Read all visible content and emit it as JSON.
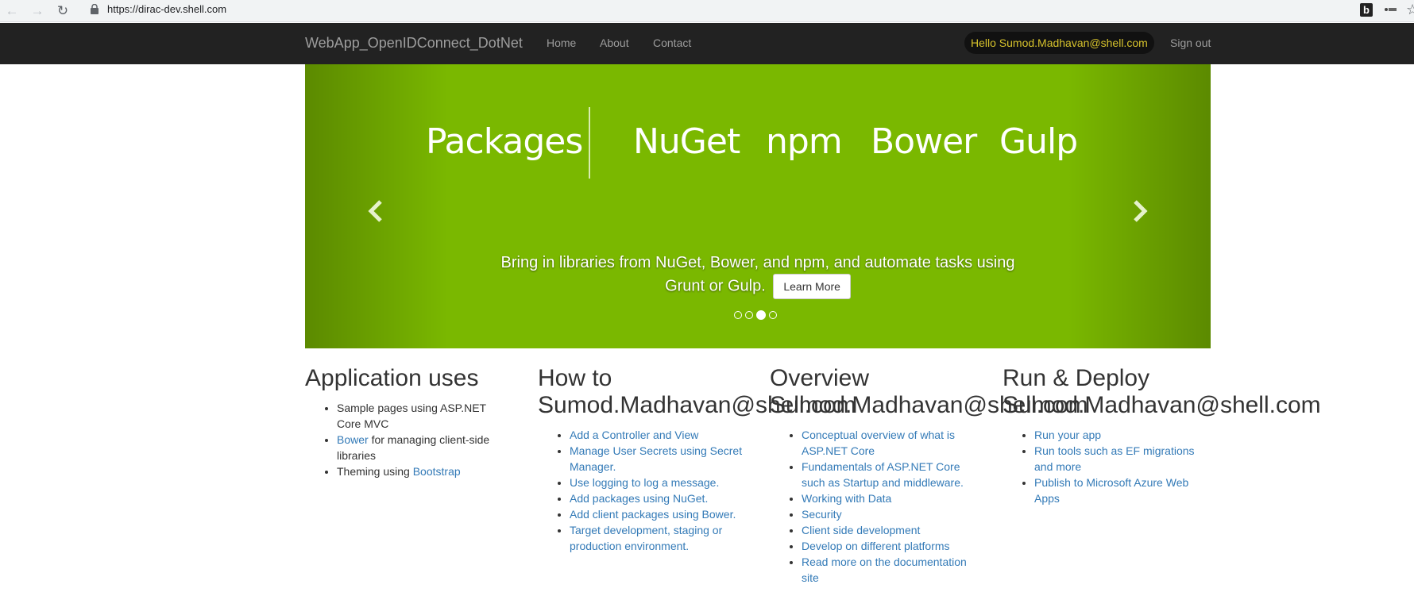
{
  "browser": {
    "url": "https://dirac-dev.shell.com"
  },
  "navbar": {
    "brand": "WebApp_OpenIDConnect_DotNet",
    "links": [
      "Home",
      "About",
      "Contact"
    ],
    "hello": "Hello Sumod.Madhavan@shell.com",
    "signout": "Sign out"
  },
  "carousel": {
    "title": "Packages",
    "items": [
      "NuGet",
      "npm",
      "Bower",
      "Gulp"
    ],
    "caption": "Bring in libraries from NuGet, Bower, and npm, and automate tasks using Grunt or Gulp.",
    "button": "Learn More",
    "active_slide": 3,
    "slide_count": 4,
    "colors": {
      "background": "#7ab800"
    }
  },
  "sections": {
    "app_uses": {
      "heading": "Application uses",
      "item1": "Sample pages using ASP.NET Core MVC",
      "item2_link": "Bower",
      "item2_text": " for managing client-side libraries",
      "item3_text": "Theming using ",
      "item3_link": "Bootstrap"
    },
    "how_to": {
      "heading_line1": "How to",
      "heading_line2": "Sumod.Madhavan@shell.com",
      "links": [
        "Add a Controller and View",
        "Manage User Secrets using Secret Manager.",
        "Use logging to log a message.",
        "Add packages using NuGet.",
        "Add client packages using Bower.",
        "Target development, staging or production environment."
      ]
    },
    "overview": {
      "heading_line1": "Overview",
      "heading_line2": "Sumod.Madhavan@shell.com",
      "links": [
        "Conceptual overview of what is ASP.NET Core",
        "Fundamentals of ASP.NET Core such as Startup and middleware.",
        "Working with Data",
        "Security",
        "Client side development",
        "Develop on different platforms",
        "Read more on the documentation site"
      ]
    },
    "run_deploy": {
      "heading_line1": "Run & Deploy",
      "heading_line2": "Sumod.Madhavan@shell.com",
      "links": [
        "Run your app",
        "Run tools such as EF migrations and more",
        "Publish to Microsoft Azure Web Apps"
      ]
    }
  }
}
